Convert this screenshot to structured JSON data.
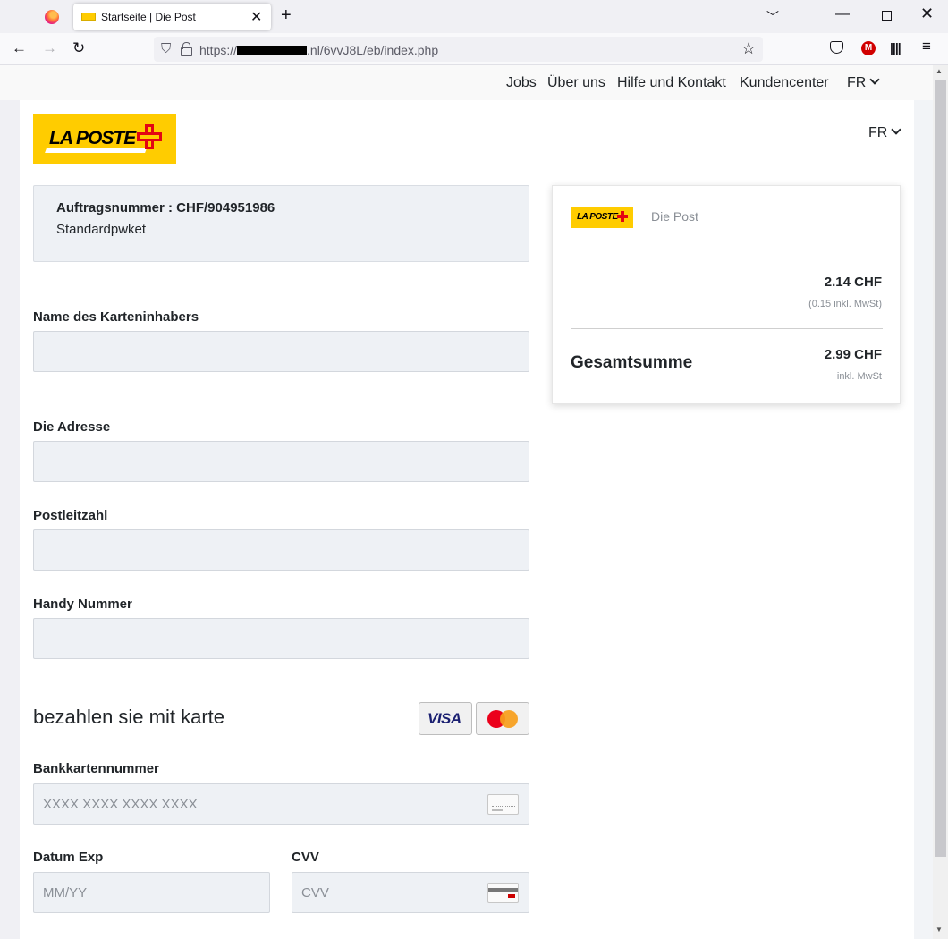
{
  "browser": {
    "tab_title": "Startseite | Die Post",
    "url_prefix": "https://",
    "url_suffix": ".nl/6vvJ8L/eb/index.php",
    "icons": [
      "firefox-logo",
      "close-tab",
      "new-tab",
      "list-tabs",
      "minimize",
      "maximize",
      "close-window",
      "back",
      "forward",
      "reload",
      "shield",
      "lock",
      "bookmark-star",
      "pocket",
      "extension-m",
      "library",
      "menu"
    ],
    "ext_letter": "M"
  },
  "topnav": {
    "links": [
      "Jobs",
      "Über uns",
      "Hilfe und Kontakt",
      "Kundencenter"
    ],
    "lang": "FR"
  },
  "header": {
    "logo_text": "LA POSTE",
    "lang": "FR"
  },
  "order": {
    "number": "Auftragsnummer : CHF/904951986",
    "type": "Standardpwket"
  },
  "form": {
    "name_label": "Name des Karteninhabers",
    "name_value": "",
    "address_label": "Die Adresse",
    "address_value": "",
    "zip_label": "Postleitzahl",
    "zip_value": "",
    "phone_label": "Handy Nummer",
    "phone_value": "",
    "pay_heading": "bezahlen sie mit karte",
    "visa_label": "VISA",
    "card_label": "Bankkartennummer",
    "card_placeholder": "XXXX XXXX XXXX XXXX",
    "exp_label": "Datum Exp",
    "exp_placeholder": "MM/YY",
    "cvv_label": "CVV",
    "cvv_placeholder": "CVV"
  },
  "summary": {
    "logo_text": "LA POSTE",
    "brand": "Die Post",
    "amount": "2.14 CHF",
    "tax": "(0.15 inkl. MwSt)",
    "total_label": "Gesamtsumme",
    "total": "2.99 CHF",
    "total_note": "inkl. MwSt"
  },
  "colors": {
    "brand_yellow": "#ffcc00",
    "brand_red": "#e30613",
    "input_bg": "#eef1f5"
  }
}
